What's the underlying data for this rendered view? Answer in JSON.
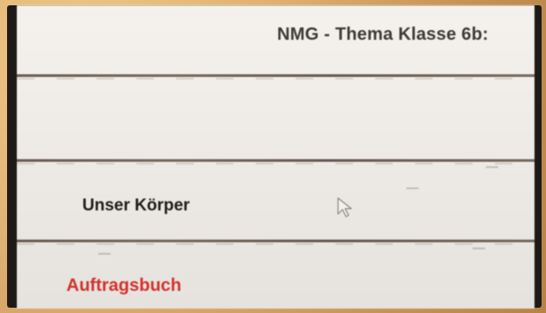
{
  "header": {
    "title": "NMG - Thema Klasse 6b:"
  },
  "content": {
    "topic_label": "Unser Körper",
    "task_book_link": "Auftragsbuch"
  },
  "icons": {
    "cursor": "mouse-pointer-icon"
  },
  "colors": {
    "screen_background": "#efece7",
    "title_text": "#3d3a37",
    "topic_text": "#1f1c1a",
    "link_red": "#d4312c",
    "frame_orange": "#d9b47a"
  }
}
